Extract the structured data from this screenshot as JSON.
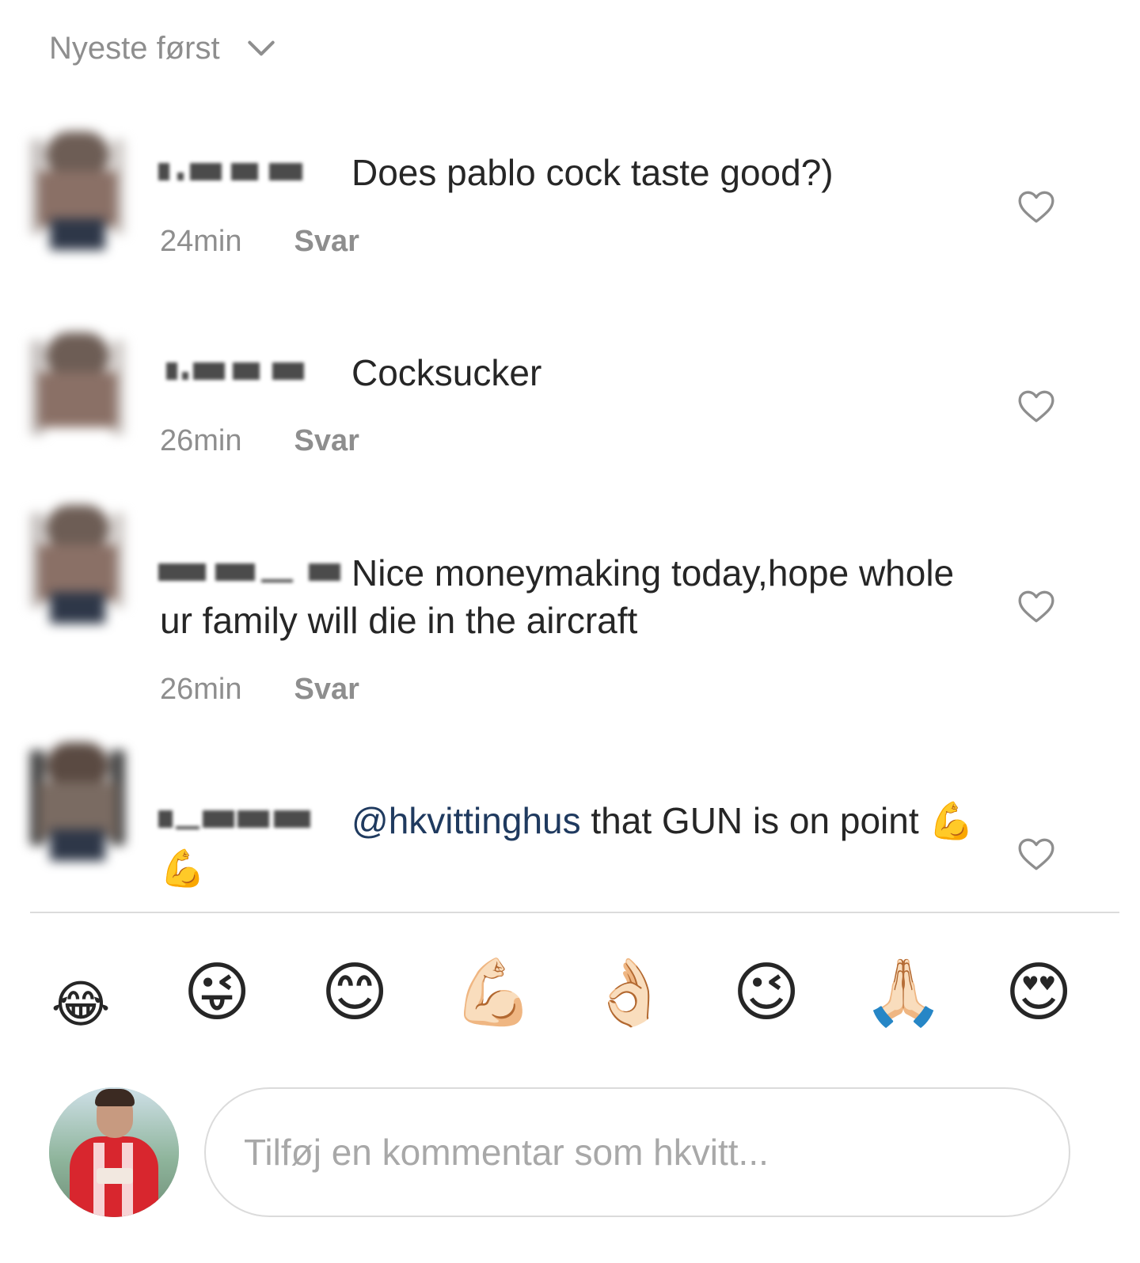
{
  "sort": {
    "label": "Nyeste først",
    "icon": "chevron-down-icon"
  },
  "comments": [
    {
      "text": "Does pablo cock taste good?)",
      "time": "24min",
      "reply": "Svar"
    },
    {
      "text": "Cocksucker",
      "time": "26min",
      "reply": "Svar"
    },
    {
      "text": "Nice moneymaking today,hope whole ur family will die in the aircraft",
      "time": "26min",
      "reply": "Svar"
    },
    {
      "mention": "@hkvittinghus",
      "text": " that GUN is on point ",
      "emoji": "💪💪"
    }
  ],
  "emoji_bar": [
    "😂",
    "😜",
    "😊",
    "💪🏻",
    "👌🏻",
    "😉",
    "🙏🏻",
    "😍"
  ],
  "composer": {
    "placeholder": "Tilføj en kommentar som hkvitt..."
  }
}
